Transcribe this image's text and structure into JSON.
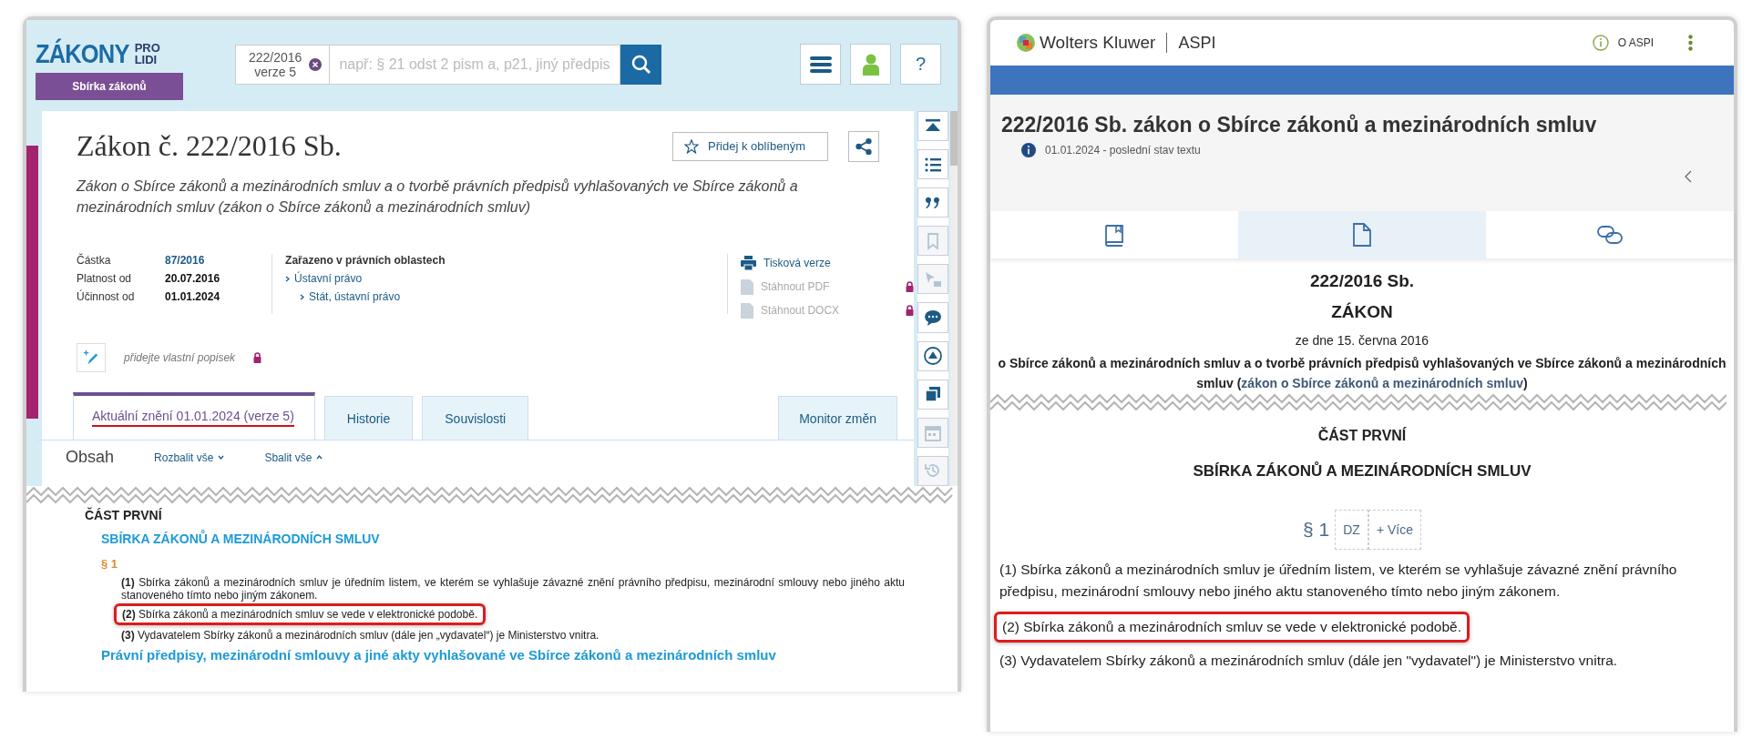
{
  "left_panel": {
    "logo": {
      "word": "ZÁKONY",
      "top": "PRO",
      "bottom": "LIDI",
      "subtitle": "Sbírka zákonů"
    },
    "search": {
      "chip": [
        "222/2016",
        "verze 5"
      ],
      "placeholder": "např: § 21 odst 2 pism a, p21, jiný předpis"
    },
    "header_buttons": [
      {
        "kind": "menu"
      },
      {
        "kind": "user"
      },
      {
        "kind": "help",
        "label": "?"
      }
    ],
    "title": "Zákon č. 222/2016 Sb.",
    "favorite_button": "Přidej k oblíbeným",
    "subtitle": "Zákon o Sbírce zákonů a mezinárodních smluv a o tvorbě právních předpisů vyhlašovaných ve Sbírce zákonů a mezinárodních smluv (zákon o Sbírce zákonů a mezinárodních smluv)",
    "meta": [
      {
        "label": "Částka",
        "value": "87/2016",
        "link": true
      },
      {
        "label": "Platnost od",
        "value": "20.07.2016",
        "link": false
      },
      {
        "label": "Účinnost od",
        "value": "01.01.2024",
        "link": false
      }
    ],
    "areas": {
      "heading": "Zařazeno v právních oblastech",
      "items": [
        {
          "label": "Ústavní právo",
          "children": [
            {
              "label": "Stát, ústavní právo"
            }
          ]
        }
      ]
    },
    "actions": [
      {
        "kind": "print",
        "label": "Tisková verze",
        "disabled": false,
        "locked": false
      },
      {
        "kind": "pdf",
        "label": "Stáhnout PDF",
        "disabled": true,
        "locked": true
      },
      {
        "kind": "docx",
        "label": "Stáhnout DOCX",
        "disabled": true,
        "locked": true
      }
    ],
    "custom_label": {
      "placeholder": "přidejte vlastní popisek",
      "locked": true
    },
    "tabs": [
      {
        "label": "Aktuální znění 01.01.2024 (verze 5)",
        "selected": true,
        "annotated": true
      },
      {
        "label": "Historie",
        "selected": false,
        "annotated": false
      },
      {
        "label": "Souvislosti",
        "selected": false,
        "annotated": false
      }
    ],
    "monitor_tab": "Monitor změn",
    "contents": {
      "title": "Obsah",
      "expand": "Rozbalit vše",
      "collapse": "Sbalit vše"
    },
    "tools": [
      {
        "kind": "top",
        "disabled": false
      },
      {
        "kind": "list",
        "disabled": false
      },
      {
        "kind": "quote",
        "disabled": false
      },
      {
        "kind": "bookmark",
        "disabled": true
      },
      {
        "kind": "select",
        "disabled": true
      },
      {
        "kind": "comment",
        "disabled": false
      },
      {
        "kind": "up",
        "disabled": false
      },
      {
        "kind": "copy",
        "disabled": false
      },
      {
        "kind": "calendar",
        "disabled": true
      },
      {
        "kind": "history",
        "disabled": true
      }
    ],
    "document": {
      "part": "ČÁST PRVNÍ",
      "heading": "SBÍRKA ZÁKONŮ A MEZINÁRODNÍCH SMLUV",
      "section": "§ 1",
      "paragraphs": [
        {
          "number": "(1)",
          "text": "Sbírka zákonů a mezinárodních smluv je úředním listem, ve kterém se vyhlašuje závazné znění právního předpisu, mezinárodní smlouvy nebo jiného aktu stanoveného tímto nebo jiným zákonem.",
          "highlighted": false
        },
        {
          "number": "(2)",
          "text": "Sbírka zákonů a mezinárodních smluv se vede v elektronické podobě.",
          "highlighted": true
        },
        {
          "number": "(3)",
          "text": "Vydavatelem Sbírky zákonů a mezinárodních smluv (dále jen „vydavatel“) je Ministerstvo vnitra.",
          "highlighted": false
        }
      ],
      "next_heading": "Právní předpisy, mezinárodní smlouvy a jiné akty vyhlašované ve Sbírce zákonů a mezinárodních smluv"
    }
  },
  "right_panel": {
    "brand": "Wolters Kluwer",
    "product": "ASPI",
    "about_link": "O ASPI",
    "title": "222/2016 Sb. zákon o Sbírce zákonů a mezinárodních smluv",
    "status": "01.01.2024 - poslední stav textu",
    "tabs": [
      {
        "kind": "book",
        "selected": false
      },
      {
        "kind": "document",
        "selected": true
      },
      {
        "kind": "link",
        "selected": false
      }
    ],
    "document": {
      "number": "222/2016 Sb.",
      "type": "ZÁKON",
      "date": "ze dne 15. června 2016",
      "title_text": "o Sbírce zákonů a mezinárodních smluv a o tvorbě právních předpisů vyhlašovaných ve Sbírce zákonů a mezinárodních smluv (",
      "title_link": "zákon o Sbírce zákonů a mezinárodních smluv",
      "title_end": ")",
      "part": "ČÁST PRVNÍ",
      "heading": "SBÍRKA ZÁKONŮ A MEZINÁRODNÍCH SMLUV",
      "section": "§ 1",
      "section_buttons": [
        "DZ",
        "+ Více"
      ],
      "paragraphs": [
        {
          "text": "(1) Sbírka zákonů a mezinárodních smluv je úředním listem, ve kterém se vyhlašuje závazné znění právního předpisu, mezinárodní smlouvy nebo jiného aktu stanoveného tímto nebo jiným zákonem.",
          "highlighted": false
        },
        {
          "text": "(2) Sbírka zákonů a mezinárodních smluv se vede v elektronické podobě.",
          "highlighted": true
        },
        {
          "text": "(3) Vydavatelem Sbírky zákonů a mezinárodních smluv (dále jen \"vydavatel\") je Ministerstvo vnitra.",
          "highlighted": false
        }
      ]
    }
  }
}
